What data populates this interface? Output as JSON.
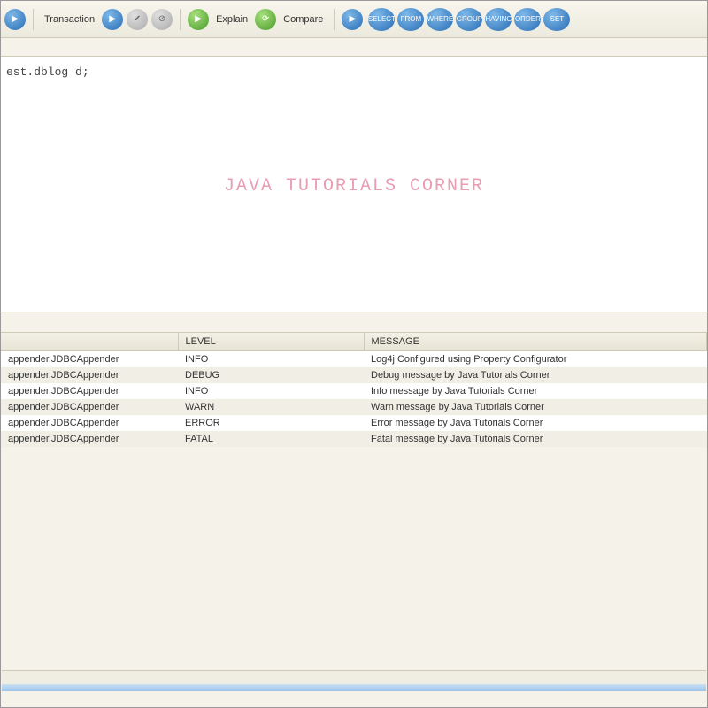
{
  "toolbar": {
    "transaction_label": "Transaction",
    "explain_label": "Explain",
    "compare_label": "Compare",
    "sql_buttons": [
      "SELECT",
      "FROM",
      "WHERE",
      "GROUP",
      "HAVING",
      "ORDER",
      "SET"
    ]
  },
  "editor": {
    "text": "est.dblog d;",
    "watermark": "JAVA TUTORIALS CORNER"
  },
  "grid": {
    "headers": [
      "",
      "LEVEL",
      "MESSAGE"
    ],
    "rows": [
      {
        "appender": "appender.JDBCAppender",
        "level": "INFO",
        "message": "Log4j Configured using Property Configurator"
      },
      {
        "appender": "appender.JDBCAppender",
        "level": "DEBUG",
        "message": "Debug message by Java Tutorials Corner"
      },
      {
        "appender": "appender.JDBCAppender",
        "level": "INFO",
        "message": "Info message by Java Tutorials Corner"
      },
      {
        "appender": "appender.JDBCAppender",
        "level": "WARN",
        "message": "Warn message by Java Tutorials Corner"
      },
      {
        "appender": "appender.JDBCAppender",
        "level": "ERROR",
        "message": "Error message by Java Tutorials Corner"
      },
      {
        "appender": "appender.JDBCAppender",
        "level": "FATAL",
        "message": "Fatal message by Java Tutorials Corner"
      }
    ]
  }
}
